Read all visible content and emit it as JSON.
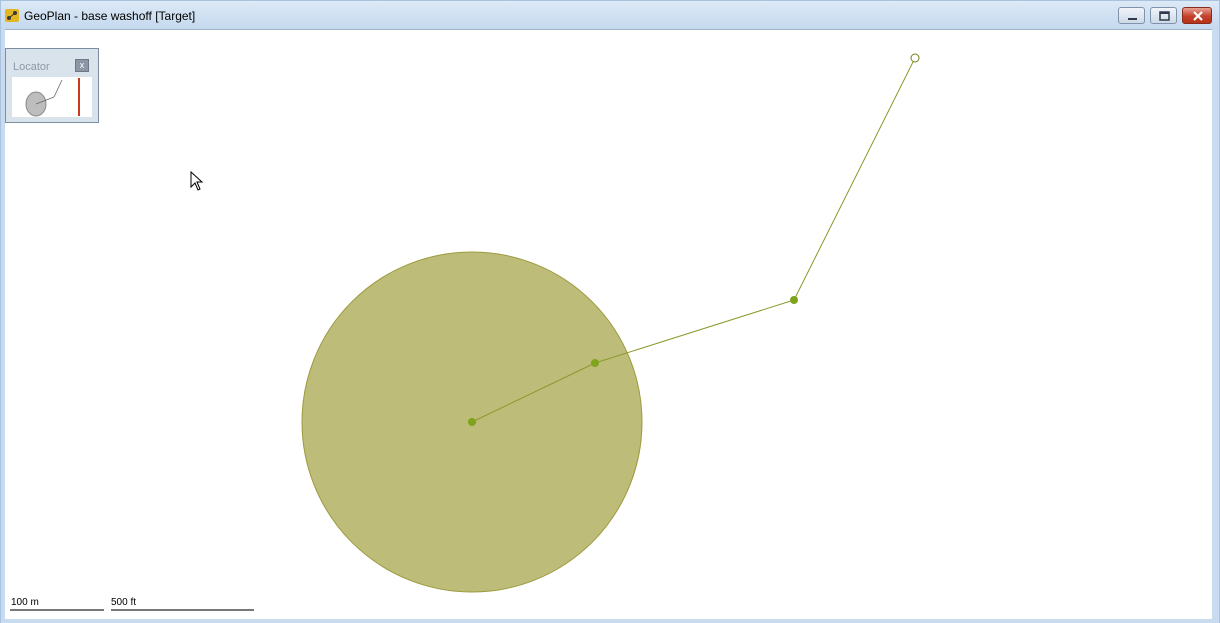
{
  "window": {
    "title": "GeoPlan - base washoff [Target]",
    "minimize_icon": "minimize-icon",
    "maximize_icon": "restore-icon",
    "close_icon": "close-icon"
  },
  "locator": {
    "title": "Locator",
    "close_label": "x"
  },
  "map": {
    "catchment_color": "#bdbc79",
    "link_color": "#8a9a2a",
    "node_color": "#7fa31a"
  },
  "scale": {
    "metric_label": "100 m",
    "imperial_label": "500 ft"
  }
}
